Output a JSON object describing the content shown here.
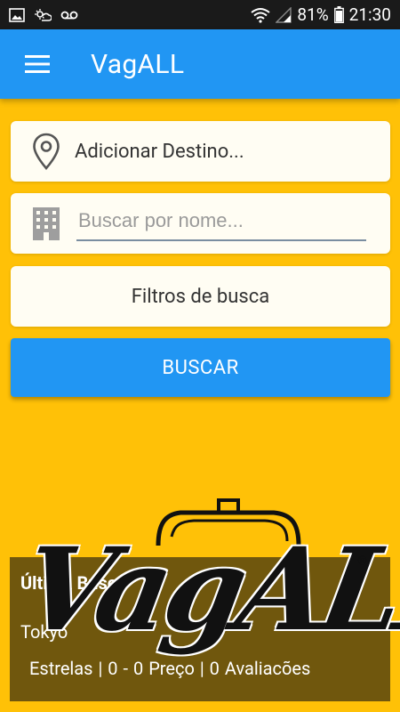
{
  "status_bar": {
    "battery": "81%",
    "time": "21:30"
  },
  "app_bar": {
    "title": "VagALL"
  },
  "search": {
    "destination_label": "Adicionar Destino...",
    "name_placeholder": "Buscar por nome...",
    "filters_label": "Filtros de busca",
    "search_button": "BUSCAR"
  },
  "last_search": {
    "title": "Última Busca",
    "city": "Tokyo",
    "stats": "Estrelas |  0 - 0  Preço |  0  Avaliacões"
  },
  "logo": {
    "text": "VagALL",
    "mark": "®"
  },
  "colors": {
    "background": "#FFC107",
    "primary": "#2196F3",
    "status_bar": "#1a1a1a",
    "card": "#FFFDF3"
  }
}
